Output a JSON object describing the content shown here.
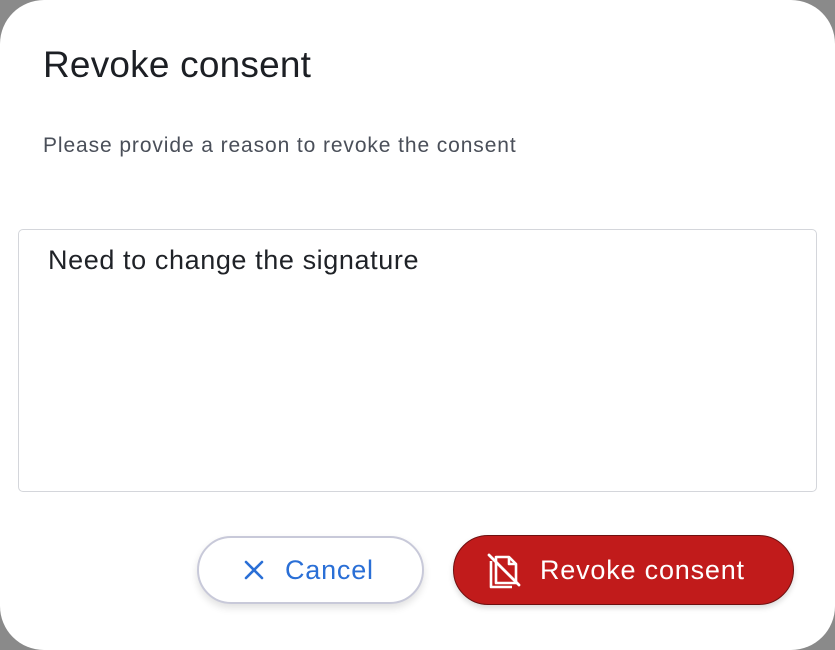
{
  "dialog": {
    "title": "Revoke consent",
    "subtitle": "Please provide a reason to revoke the consent",
    "reason": {
      "value": "Need to change the signature",
      "placeholder": ""
    },
    "buttons": {
      "cancel": {
        "label": "Cancel",
        "icon": "close-icon"
      },
      "revoke": {
        "label": "Revoke consent",
        "icon": "document-off-icon"
      }
    }
  },
  "colors": {
    "primary": "#2a6fd6",
    "danger": "#c11b1b"
  }
}
